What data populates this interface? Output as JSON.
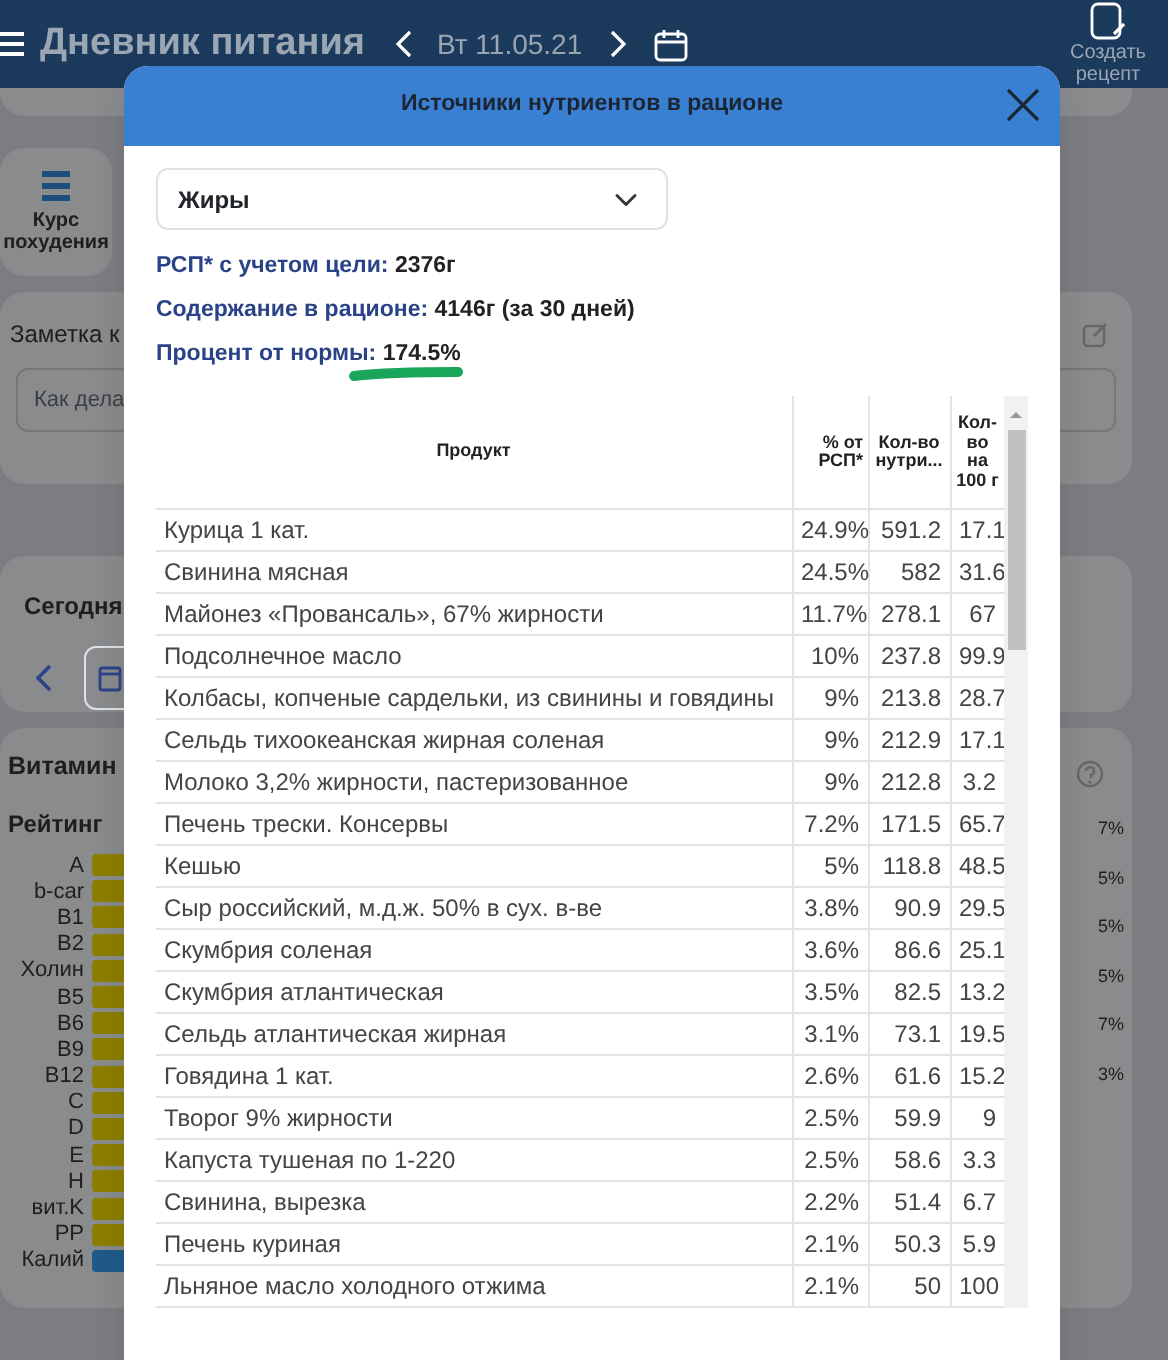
{
  "app_header": {
    "title": "Дневник питания",
    "date": "Вт 11.05.21",
    "create_recipe": "Создать рецепт"
  },
  "background": {
    "tile": "Курс похудения",
    "note": {
      "title": "Заметка к",
      "placeholder": "Как дела"
    },
    "today": {
      "title": "Сегодня"
    },
    "vitamins": {
      "title": "Витамин",
      "rating": "Рейтинг",
      "bars": [
        {
          "name": "A",
          "color": "#8c7e00"
        },
        {
          "name": "b-car",
          "color": "#8c7e00"
        },
        {
          "name": "B1",
          "color": "#8c7e00"
        },
        {
          "name": "B2",
          "color": "#8c7e00"
        },
        {
          "name": "Холин",
          "color": "#8c7e00"
        },
        {
          "name": "B5",
          "color": "#8c7e00"
        },
        {
          "name": "B6",
          "color": "#8c7e00"
        },
        {
          "name": "B9",
          "color": "#8c7e00"
        },
        {
          "name": "B12",
          "color": "#8c7e00"
        },
        {
          "name": "C",
          "color": "#8c7e00"
        },
        {
          "name": "D",
          "color": "#8c7e00"
        },
        {
          "name": "E",
          "color": "#8c7e00"
        },
        {
          "name": "H",
          "color": "#8c7e00"
        },
        {
          "name": "вит.K",
          "color": "#8c7e00"
        },
        {
          "name": "PP",
          "color": "#8c7e00"
        },
        {
          "name": "Калий",
          "color": "#1e5a8a"
        }
      ],
      "percents": [
        "7%",
        "5%",
        "5%",
        "5%",
        "7%",
        "3%"
      ]
    }
  },
  "modal": {
    "title": "Источники нутриентов в рационе",
    "select": "Жиры",
    "stats": [
      {
        "label": "РСП* с учетом цели:",
        "value": "2376г",
        "highlighted": false
      },
      {
        "label": "Содержание в рационе:",
        "value": "4146г (за 30 дней)",
        "highlighted": false
      },
      {
        "label": "Процент от нормы:",
        "value": "174.5%",
        "highlighted": true
      }
    ],
    "table": {
      "columns": [
        "Продукт",
        "% от РСП*",
        "Кол-во нутри...",
        "Кол-во на 100 г"
      ],
      "rows": [
        [
          "Курица 1 кат.",
          "24.9%",
          "591.2",
          "17.1"
        ],
        [
          "Свинина мясная",
          "24.5%",
          "582",
          "31.6"
        ],
        [
          "Майонез «Провансаль», 67% жирности",
          "11.7%",
          "278.1",
          "67"
        ],
        [
          "Подсолнечное масло",
          "10%",
          "237.8",
          "99.9"
        ],
        [
          "Колбасы, копченые сардельки, из свинины и говядины",
          "9%",
          "213.8",
          "28.7"
        ],
        [
          "Сельдь тихоокеанская жирная соленая",
          "9%",
          "212.9",
          "17.1"
        ],
        [
          "Молоко 3,2% жирности, пастеризованное",
          "9%",
          "212.8",
          "3.2"
        ],
        [
          "Печень трески. Консервы",
          "7.2%",
          "171.5",
          "65.7"
        ],
        [
          "Кешью",
          "5%",
          "118.8",
          "48.5"
        ],
        [
          "Сыр российский, м.д.ж. 50% в сух. в-ве",
          "3.8%",
          "90.9",
          "29.5"
        ],
        [
          "Скумбрия соленая",
          "3.6%",
          "86.6",
          "25.1"
        ],
        [
          "Скумбрия атлантическая",
          "3.5%",
          "82.5",
          "13.2"
        ],
        [
          "Сельдь атлантическая жирная",
          "3.1%",
          "73.1",
          "19.5"
        ],
        [
          "Говядина 1 кат.",
          "2.6%",
          "61.6",
          "15.2"
        ],
        [
          "Творог 9% жирности",
          "2.5%",
          "59.9",
          "9"
        ],
        [
          "Капуста тушеная по 1-220",
          "2.5%",
          "58.6",
          "3.3"
        ],
        [
          "Свинина, вырезка",
          "2.2%",
          "51.4",
          "6.7"
        ],
        [
          "Печень куриная",
          "2.1%",
          "50.3",
          "5.9"
        ],
        [
          "Льняное масло холодного отжима",
          "2.1%",
          "50",
          "100"
        ]
      ]
    }
  }
}
